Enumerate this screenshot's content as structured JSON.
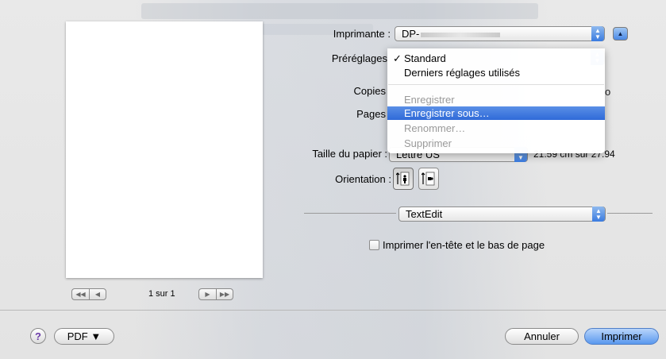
{
  "preview": {
    "nav_first": "◀◀",
    "nav_prev": "◀",
    "page_info": "1 sur 1",
    "nav_next": "▶",
    "nav_last": "▶▶"
  },
  "printer": {
    "label": "Imprimante :",
    "value": "DP-"
  },
  "presets": {
    "label": "Préréglages",
    "menu": [
      {
        "label": "Standard",
        "checked": true,
        "enabled": true
      },
      {
        "label": "Derniers réglages utilisés",
        "enabled": true
      },
      {
        "label": "Enregistrer",
        "enabled": false
      },
      {
        "label": "Enregistrer sous…",
        "enabled": true,
        "highlighted": true
      },
      {
        "label": "Renommer…",
        "enabled": false
      },
      {
        "label": "Supprimer",
        "enabled": false
      }
    ],
    "check_mark": "✓"
  },
  "copies": {
    "label": "Copies",
    "ghost_trailing": "o"
  },
  "pages": {
    "label": "Pages"
  },
  "paper": {
    "label": "Taille du papier :",
    "value": "Lettre US",
    "dimensions": "21.59 cm sur 27.94"
  },
  "orientation": {
    "label": "Orientation :"
  },
  "app_section": {
    "value": "TextEdit"
  },
  "header_footer": {
    "label": "Imprimer l'en-tête et le bas de page",
    "checked": false
  },
  "bottom": {
    "help": "?",
    "pdf": "PDF ▼",
    "cancel": "Annuler",
    "print": "Imprimer"
  }
}
